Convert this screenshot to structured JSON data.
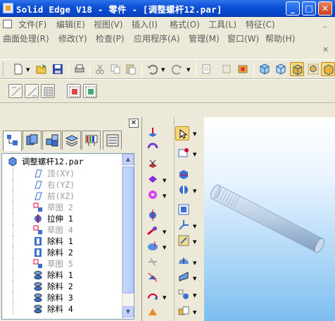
{
  "window": {
    "title": "Solid Edge V18 - 零件 - [调整螺杆12.par]",
    "minimize_glyph": "_",
    "maximize_glyph": "□",
    "close_glyph": "✕"
  },
  "menubar1": {
    "items": [
      "文件(F)",
      "编辑(E)",
      "视图(V)",
      "插入(I)",
      "格式(O)",
      "工具(L)",
      "特征(C)"
    ]
  },
  "menubar2": {
    "items": [
      "曲面处理(R)",
      "修改(Y)",
      "检查(P)",
      "应用程序(A)",
      "管理(M)",
      "窗口(W)",
      "帮助(H)"
    ],
    "doc_minimize_glyph": "_",
    "doc_close_glyph": "✕"
  },
  "edgebar": {
    "close_glyph": "✕",
    "tabs": [
      "feature-pathfinder-icon",
      "library-icon",
      "family-of-parts-icon",
      "layers-icon",
      "sensors-icon",
      "feature-library-icon"
    ]
  },
  "tree": {
    "root": "调整螺杆12.par",
    "items": [
      {
        "label": "顶(XY)",
        "icon": "reference-plane-icon",
        "dim": true
      },
      {
        "label": "右(YZ)",
        "icon": "reference-plane-icon",
        "dim": true
      },
      {
        "label": "前(XZ)",
        "icon": "reference-plane-icon",
        "dim": true
      },
      {
        "label": "草图 2",
        "icon": "sketch-icon",
        "dim": true
      },
      {
        "label": "拉伸 1",
        "icon": "protrusion-icon",
        "dim": false
      },
      {
        "label": "草图 4",
        "icon": "sketch-icon",
        "dim": true
      },
      {
        "label": "除料 1",
        "icon": "cutout-icon",
        "dim": false
      },
      {
        "label": "除料 2",
        "icon": "cutout-icon",
        "dim": false
      },
      {
        "label": "草图 5",
        "icon": "sketch-icon",
        "dim": true
      },
      {
        "label": "除料 1",
        "icon": "revolved-cutout-icon",
        "dim": false
      },
      {
        "label": "除料 2",
        "icon": "revolved-cutout-icon",
        "dim": false
      },
      {
        "label": "除料 3",
        "icon": "revolved-cutout-icon",
        "dim": false
      },
      {
        "label": "除料 4",
        "icon": "revolved-cutout-icon",
        "dim": false
      }
    ],
    "scroll_up_glyph": "▲",
    "scroll_down_glyph": "▼"
  },
  "colors": {
    "titlebar": "#0a4fd6",
    "toolbar_bg": "#ece9d8",
    "viewport_top": "#ffffff",
    "viewport_bottom": "#7cbdf0",
    "part_body": "#b8c8d8"
  }
}
